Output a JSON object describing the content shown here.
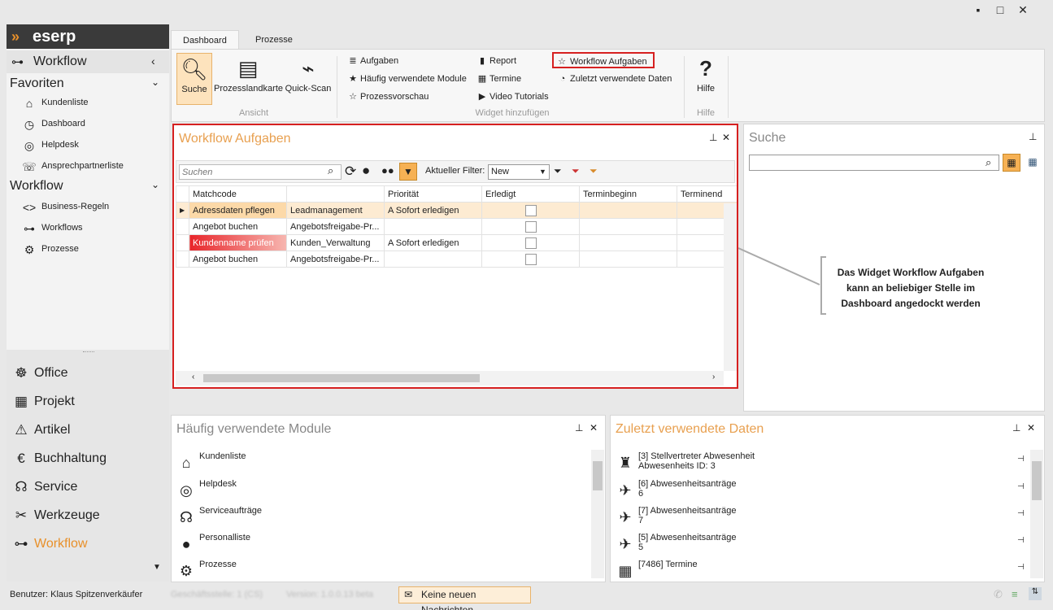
{
  "window": {
    "minimize": "▪",
    "maximize": "□",
    "close": "✕"
  },
  "app": {
    "logo": "eserp"
  },
  "sidebar": {
    "section_title": "Workflow",
    "favoriten_header": "Favoriten",
    "favoriten": [
      {
        "label": "Kundenliste",
        "icon": "home-icon"
      },
      {
        "label": "Dashboard",
        "icon": "dashboard-icon"
      },
      {
        "label": "Helpdesk",
        "icon": "lifebuoy-icon"
      },
      {
        "label": "Ansprechpartnerliste",
        "icon": "contact-icon"
      }
    ],
    "workflow_header": "Workflow",
    "workflow_items": [
      {
        "label": "Business-Regeln",
        "icon": "code-icon"
      },
      {
        "label": "Workflows",
        "icon": "workflow-icon"
      },
      {
        "label": "Prozesse",
        "icon": "gears-icon"
      }
    ],
    "modules": [
      {
        "label": "Office",
        "icon": "helm-icon"
      },
      {
        "label": "Projekt",
        "icon": "gantt-icon"
      },
      {
        "label": "Artikel",
        "icon": "alert-light-icon"
      },
      {
        "label": "Buchhaltung",
        "icon": "euro-icon"
      },
      {
        "label": "Service",
        "icon": "headset-icon"
      },
      {
        "label": "Werkzeuge",
        "icon": "tools-icon"
      },
      {
        "label": "Workflow",
        "icon": "workflow-icon"
      }
    ],
    "active_color": "#e8902a"
  },
  "ribbon": {
    "tabs": [
      "Dashboard",
      "Prozesse"
    ],
    "ansicht": {
      "label": "Ansicht",
      "buttons": [
        "Suche",
        "Prozesslandkarte",
        "Quick-Scan"
      ]
    },
    "widget": {
      "label": "Widget hinzufügen",
      "col1": [
        "Aufgaben",
        "Häufig verwendete Module",
        "Prozessvorschau"
      ],
      "col2": [
        "Report",
        "Termine",
        "Video Tutorials"
      ],
      "col3": [
        "Workflow Aufgaben",
        "Zuletzt verwendete Daten"
      ]
    },
    "hilfe": {
      "label": "Hilfe",
      "button": "Hilfe"
    }
  },
  "workflow_panel": {
    "title": "Workflow Aufgaben",
    "search_placeholder": "Suchen",
    "filter_label": "Aktueller Filter:",
    "filter_value": "New",
    "columns": [
      "Matchcode",
      "",
      "Priorität",
      "Erledigt",
      "Terminbeginn",
      "Terminend"
    ],
    "rows": [
      {
        "matchcode": "Adressdaten pflegen",
        "process": "Leadmanagement",
        "priority": "A Sofort erledigen"
      },
      {
        "matchcode": "Angebot buchen",
        "process": "Angebotsfreigabe-Pr...",
        "priority": ""
      },
      {
        "matchcode": "Kundenname prüfen",
        "process": "Kunden_Verwaltung",
        "priority": "A Sofort erledigen"
      },
      {
        "matchcode": "Angebot buchen",
        "process": "Angebotsfreigabe-Pr...",
        "priority": ""
      }
    ]
  },
  "suche_panel": {
    "title": "Suche"
  },
  "callout": {
    "line1": "Das Widget Workflow Aufgaben",
    "line2": "kann an beliebiger Stelle im",
    "line3": "Dashboard angedockt werden"
  },
  "modules_panel": {
    "title": "Häufig verwendete Module",
    "items": [
      {
        "label": "Kundenliste",
        "icon": "home-icon"
      },
      {
        "label": "Helpdesk",
        "icon": "lifebuoy-icon"
      },
      {
        "label": "Serviceaufträge",
        "icon": "headset-icon"
      },
      {
        "label": "Personalliste",
        "icon": "person-icon"
      },
      {
        "label": "Prozesse",
        "icon": "gears-icon"
      }
    ]
  },
  "recent_panel": {
    "title": "Zuletzt verwendete Daten",
    "items": [
      {
        "line1": "[3] Stellvertreter Abwesenheit",
        "line2": "Abwesenheits ID: 3",
        "icon": "desk-icon"
      },
      {
        "line1": "[6] Abwesenheitsanträge",
        "line2": "6",
        "icon": "traveler-icon"
      },
      {
        "line1": "[7] Abwesenheitsanträge",
        "line2": "7",
        "icon": "traveler-icon"
      },
      {
        "line1": "[5] Abwesenheitsanträge",
        "line2": "5",
        "icon": "traveler-icon"
      },
      {
        "line1": "[7486] Termine",
        "line2": "",
        "icon": "calendar-icon"
      }
    ]
  },
  "status": {
    "user": "Benutzer: Klaus Spitzenverkäufer",
    "branch": "Geschäftsstelle: 1 (CS)",
    "version": "Version: 1.0.0.13 beta",
    "messages": "Keine neuen Nachrichten"
  }
}
